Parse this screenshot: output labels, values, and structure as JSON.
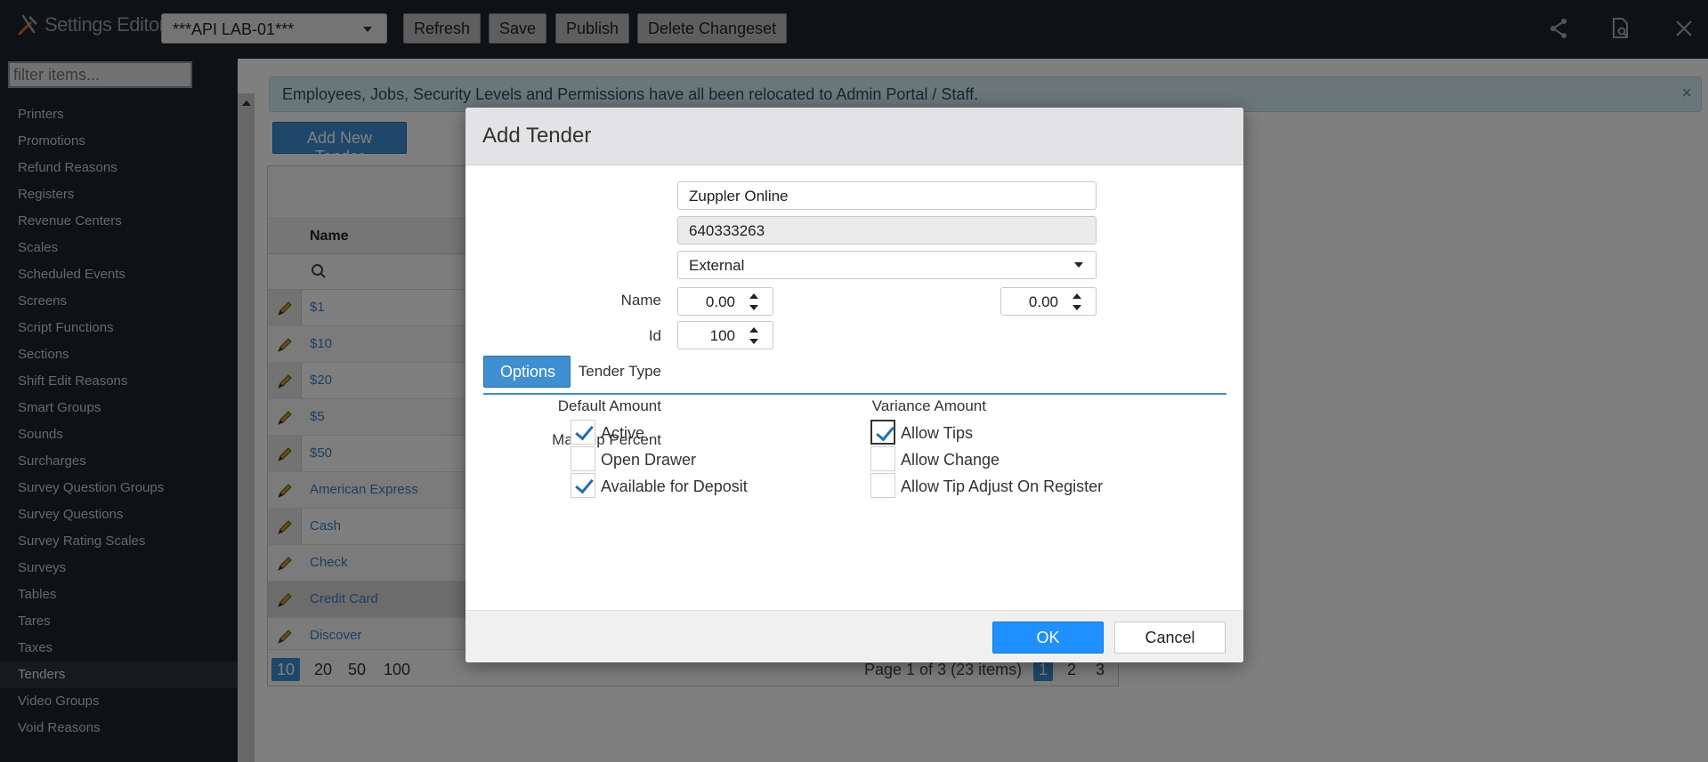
{
  "app": {
    "title": "Settings Editor"
  },
  "toolbar": {
    "site": "***API LAB-01***",
    "refresh_label": "Refresh",
    "save_label": "Save",
    "publish_label": "Publish",
    "delete_label": "Delete Changeset",
    "icons": [
      "share-icon",
      "document-search-icon",
      "close-icon"
    ]
  },
  "sidebar": {
    "filter_placeholder": "filter items...",
    "items": [
      {
        "label": "Printers"
      },
      {
        "label": "Promotions"
      },
      {
        "label": "Refund Reasons"
      },
      {
        "label": "Registers"
      },
      {
        "label": "Revenue Centers"
      },
      {
        "label": "Scales"
      },
      {
        "label": "Scheduled Events"
      },
      {
        "label": "Screens"
      },
      {
        "label": "Script Functions"
      },
      {
        "label": "Sections"
      },
      {
        "label": "Shift Edit Reasons"
      },
      {
        "label": "Smart Groups"
      },
      {
        "label": "Sounds"
      },
      {
        "label": "Surcharges"
      },
      {
        "label": "Survey Question Groups"
      },
      {
        "label": "Survey Questions"
      },
      {
        "label": "Survey Rating Scales"
      },
      {
        "label": "Surveys"
      },
      {
        "label": "Tables"
      },
      {
        "label": "Tares"
      },
      {
        "label": "Taxes"
      },
      {
        "label": "Tenders"
      },
      {
        "label": "Video Groups"
      },
      {
        "label": "Void Reasons"
      }
    ],
    "active": "Tenders"
  },
  "main": {
    "banner": "Employees, Jobs, Security Levels and Permissions have all been relocated to Admin Portal / Staff.",
    "banner_close": "×",
    "add_button": "Add New Tender",
    "grid": {
      "column_name": "Name",
      "rows": [
        "$1",
        "$10",
        "$20",
        "$5",
        "$50",
        "American Express",
        "Cash",
        "Check",
        "Credit Card",
        "Discover"
      ],
      "selected_row": "Credit Card",
      "page_sizes": [
        "10",
        "20",
        "50",
        "100"
      ],
      "current_page_size": "10",
      "page_info": "Page 1 of 3 (23 items)",
      "pages": [
        "1",
        "2",
        "3"
      ],
      "current_page": "1"
    }
  },
  "dialog": {
    "title": "Add Tender",
    "name_label": "Name",
    "name_value": "Zuppler Online",
    "id_label": "Id",
    "id_value": "640333263",
    "tender_type_label": "Tender Type",
    "tender_type_value": "External",
    "default_amount_label": "Default Amount",
    "default_amount_value": "0.00",
    "variance_amount_label": "Variance Amount",
    "variance_amount_value": "0.00",
    "max_tip_label": "Max Tip Percent",
    "max_tip_value": "100",
    "options_tab": "Options",
    "options": [
      {
        "label": "Active",
        "checked": true
      },
      {
        "label": "Open Drawer",
        "checked": false
      },
      {
        "label": "Available for Deposit",
        "checked": true
      },
      {
        "label": "Allow Tips",
        "checked": true
      },
      {
        "label": "Allow Change",
        "checked": false
      },
      {
        "label": "Allow Tip Adjust On Register",
        "checked": false
      }
    ],
    "ok_label": "OK",
    "cancel_label": "Cancel"
  },
  "colors": {
    "topbar_bg": "#1f252b",
    "accent": "#3f8fd2",
    "ok_button": "#1e90ff"
  }
}
